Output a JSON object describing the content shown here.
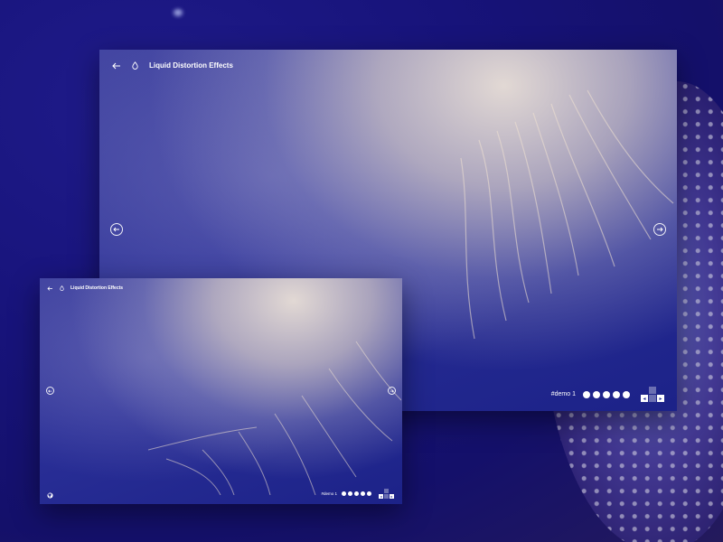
{
  "colors": {
    "background": "#17137a",
    "accent": "#ffffff",
    "panel": "#2a2f97"
  },
  "large": {
    "header": {
      "back_icon": "arrow-left-icon",
      "logo_icon": "drop-icon",
      "title": "Liquid Distortion Effects"
    },
    "nav": {
      "prev_icon": "arrow-left-circle-icon",
      "next_icon": "arrow-right-circle-icon"
    },
    "footer": {
      "demo_label": "#demo 1",
      "dot_count": 5,
      "controls": [
        "prev-icon",
        "up-icon",
        "next-icon"
      ]
    }
  },
  "small": {
    "header": {
      "back_icon": "arrow-left-icon",
      "logo_icon": "drop-icon",
      "title": "Liquid Distortion Effects"
    },
    "nav": {
      "prev_icon": "arrow-left-circle-icon",
      "next_icon": "arrow-right-circle-icon"
    },
    "footer": {
      "github_icon": "github-icon",
      "demo_label": "#demo 1",
      "dot_count": 5,
      "controls": [
        "prev-icon",
        "up-icon",
        "next-icon"
      ]
    }
  }
}
